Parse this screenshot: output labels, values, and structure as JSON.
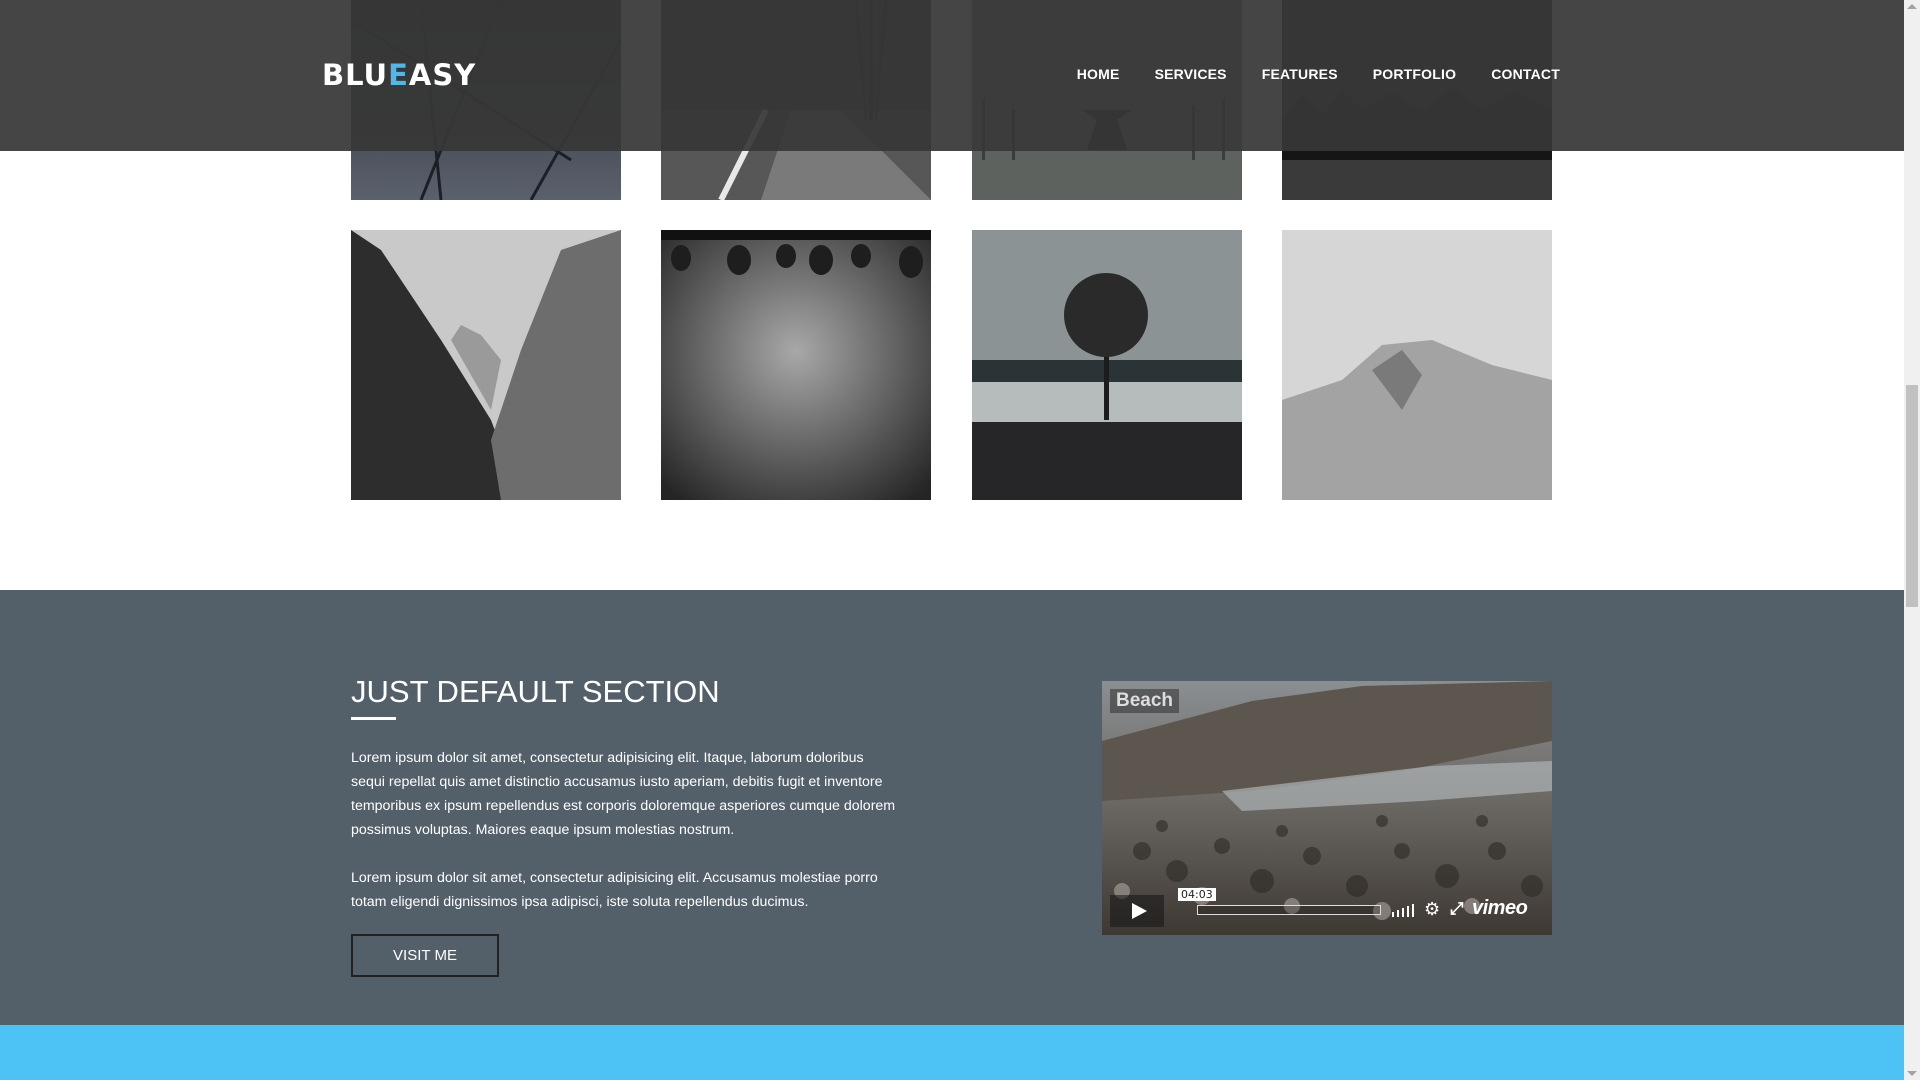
{
  "header": {
    "logo_part1": "BLU",
    "logo_accent": "E",
    "logo_part2": "ASY",
    "nav": [
      "HOME",
      "SERVICES",
      "FEATURES",
      "PORTFOLIO",
      "CONTACT"
    ]
  },
  "default_section": {
    "title": "JUST DEFAULT SECTION",
    "paragraph1": "Lorem ipsum dolor sit amet, consectetur adipisicing elit. Itaque, laborum doloribus sequi repellat quis amet distinctio accusamus iusto aperiam, debitis fugit et inventore temporibus ex ipsum repellendus est corporis doloremque asperiores cumque dolorem possimus voluptas. Maiores eaque ipsum molestias nostrum.",
    "paragraph2": "Lorem ipsum dolor sit amet, consectetur adipisicing elit. Accusamus molestiae porro totam eligendi dignissimos ipsa adipisci, iste soluta repellendus ducimus.",
    "button_label": "VISIT ME"
  },
  "video": {
    "title": "Beach",
    "time": "04:03",
    "brand": "vimeo"
  },
  "colors": {
    "header_bg": "#373737",
    "logo_accent": "#4fb7ea",
    "section_bg": "#535f69",
    "footer_band": "#4dc2f5"
  }
}
